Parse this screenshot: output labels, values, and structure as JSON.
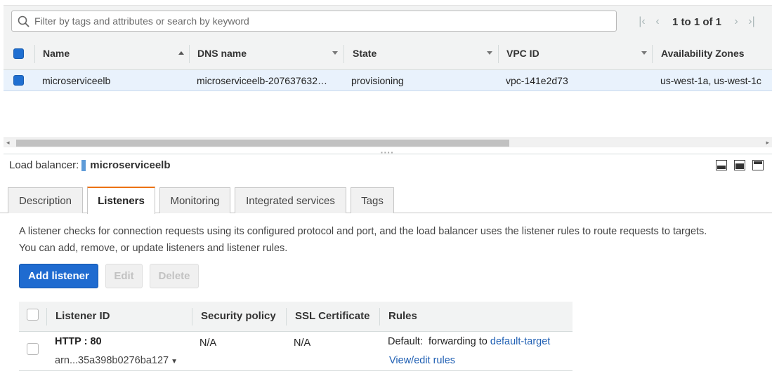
{
  "search": {
    "placeholder": "Filter by tags and attributes or search by keyword",
    "value": ""
  },
  "pager": {
    "text": "1 to 1 of 1"
  },
  "table": {
    "columns": [
      "Name",
      "DNS name",
      "State",
      "VPC ID",
      "Availability Zones"
    ],
    "rows": [
      {
        "name": "microserviceelb",
        "dns": "microserviceelb-207637632…",
        "state": "provisioning",
        "vpc": "vpc-141e2d73",
        "azs": "us-west-1a, us-west-1c"
      }
    ]
  },
  "detail": {
    "label": "Load balancer:",
    "name": "microserviceelb"
  },
  "tabs": [
    "Description",
    "Listeners",
    "Monitoring",
    "Integrated services",
    "Tags"
  ],
  "active_tab": "Listeners",
  "listeners": {
    "description_line1": "A listener checks for connection requests using its configured protocol and port, and the load balancer uses the listener rules to route requests to targets.",
    "description_line2": "You can add, remove, or update listeners and listener rules.",
    "buttons": {
      "add": "Add listener",
      "edit": "Edit",
      "delete": "Delete"
    },
    "columns": [
      "Listener ID",
      "Security policy",
      "SSL Certificate",
      "Rules"
    ],
    "rows": [
      {
        "id": "HTTP : 80",
        "arn": "arn...35a398b0276ba127",
        "security_policy": "N/A",
        "ssl_certificate": "N/A",
        "rule_prefix": "Default:  forwarding to",
        "rule_target": "default-target",
        "rule_link": "View/edit rules"
      }
    ]
  },
  "colors": {
    "accent": "#1f6bd0",
    "active_tab": "#ec7211",
    "selected_row": "#e9f2fc",
    "link": "#1f5fb3"
  }
}
